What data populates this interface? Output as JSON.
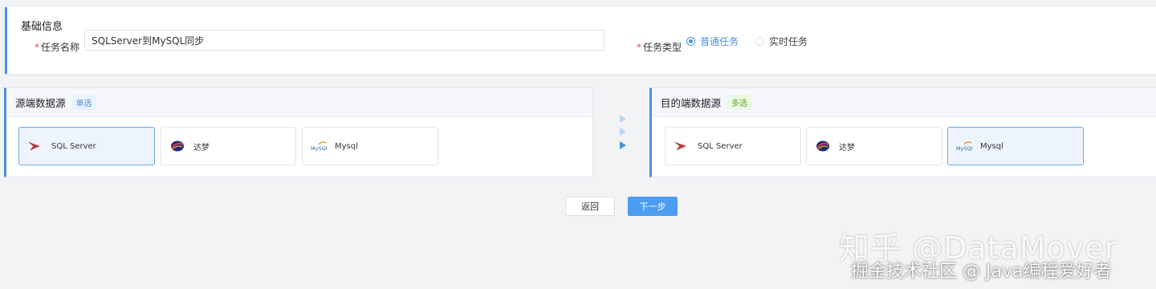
{
  "basic_info": {
    "title": "基础信息",
    "task_name_label": "任务名称",
    "task_name_value": "SQLServer到MySQL同步",
    "task_type_label": "任务类型",
    "task_type_options": [
      "普通任务",
      "实时任务"
    ],
    "task_type_selected": "普通任务",
    "required_mark": "*"
  },
  "source": {
    "title": "源端数据源",
    "tag": "单选",
    "items": [
      "SQL Server",
      "达梦",
      "Mysql"
    ],
    "selected": "SQL Server"
  },
  "target": {
    "title": "目的端数据源",
    "tag": "多选",
    "items": [
      "SQL Server",
      "达梦",
      "Mysql"
    ],
    "selected": "Mysql"
  },
  "buttons": {
    "back": "返回",
    "next": "下一步"
  },
  "watermark": {
    "line1": "知乎 @DataMover",
    "line2": "掘金技术社区 @ Java编程爱好者"
  },
  "icons": [
    "sqlserver-logo",
    "dameng-logo",
    "mysql-logo",
    "arrow-right-icon"
  ],
  "colors": {
    "accent": "#4a90e2",
    "primary_button": "#4a9df0",
    "selected_card_bg": "#eef4fd"
  }
}
